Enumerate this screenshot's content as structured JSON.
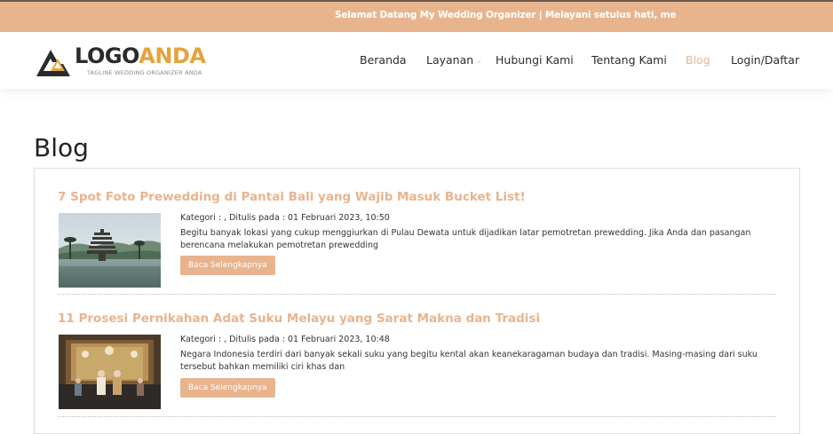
{
  "topbar": {
    "ticker": "Selamat Datang My Wedding Organizer | Melayani setulus hati, me"
  },
  "logo": {
    "word_part1": "LOGO",
    "word_part2": "ANDA",
    "tagline": "TAGLINE WEDDING ORGANIZER ANDA"
  },
  "nav": {
    "items": [
      {
        "label": "Beranda"
      },
      {
        "label": "Layanan"
      },
      {
        "label": "Hubungi Kami"
      },
      {
        "label": "Tentang Kami"
      },
      {
        "label": "Blog"
      },
      {
        "label": "Login/Daftar"
      }
    ],
    "active": "Blog"
  },
  "page": {
    "title": "Blog"
  },
  "posts": [
    {
      "title": "7 Spot Foto Prewedding di Pantai Bali yang Wajib Masuk Bucket List!",
      "meta": "Kategori : , Ditulis pada : 01 Februari 2023, 10:50",
      "excerpt": "Begitu banyak lokasi yang cukup menggiurkan di Pulau Dewata untuk dijadikan latar pemotretan prewedding. Jika Anda dan pasangan berencana melakukan pemotretan prewedding",
      "button": "Baca Selengkapnya"
    },
    {
      "title": "11 Prosesi Pernikahan Adat Suku Melayu yang Sarat Makna dan Tradisi",
      "meta": "Kategori : , Ditulis pada : 01 Februari 2023, 10:48",
      "excerpt": "Negara Indonesia terdiri dari banyak sekali suku yang begitu kental akan keanekaragaman budaya dan tradisi. Masing-masing dari suku tersebut bahkan memiliki ciri khas dan",
      "button": "Baca Selengkapnya"
    }
  ],
  "colors": {
    "accent": "#e8b48e",
    "logo_accent": "#e6a23c",
    "dark": "#2b2b2b"
  },
  "icons": {
    "layanan_dropdown": "chevron-down-icon",
    "logo_mark": "triangle-logo-icon"
  }
}
